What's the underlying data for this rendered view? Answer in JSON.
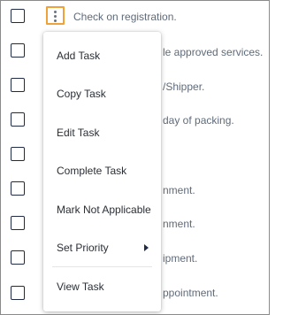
{
  "tasks": [
    {
      "text": "Check on registration.",
      "checked": false
    },
    {
      "text": "le approved services.",
      "checked": false
    },
    {
      "text": "/Shipper.",
      "checked": false
    },
    {
      "text": "day of packing.",
      "checked": false
    },
    {
      "text": "",
      "checked": false
    },
    {
      "text": "nment.",
      "checked": false
    },
    {
      "text": "nment.",
      "checked": false
    },
    {
      "text": "ipment.",
      "checked": false
    },
    {
      "text": "ppointment.",
      "checked": false
    }
  ],
  "menu": {
    "items": [
      {
        "label": "Add Task"
      },
      {
        "label": "Copy Task"
      },
      {
        "label": "Edit Task"
      },
      {
        "label": "Complete Task"
      },
      {
        "label": "Mark Not Applicable"
      },
      {
        "label": "Set Priority",
        "submenu": true
      },
      {
        "label": "View Task"
      }
    ]
  },
  "colors": {
    "kebab_highlight": "#f0a23a",
    "task_text": "#5f6b7a",
    "checkbox_border": "#1f2a44"
  },
  "icons": {
    "kebab": "more-vertical-icon",
    "submenu": "caret-right-icon"
  }
}
